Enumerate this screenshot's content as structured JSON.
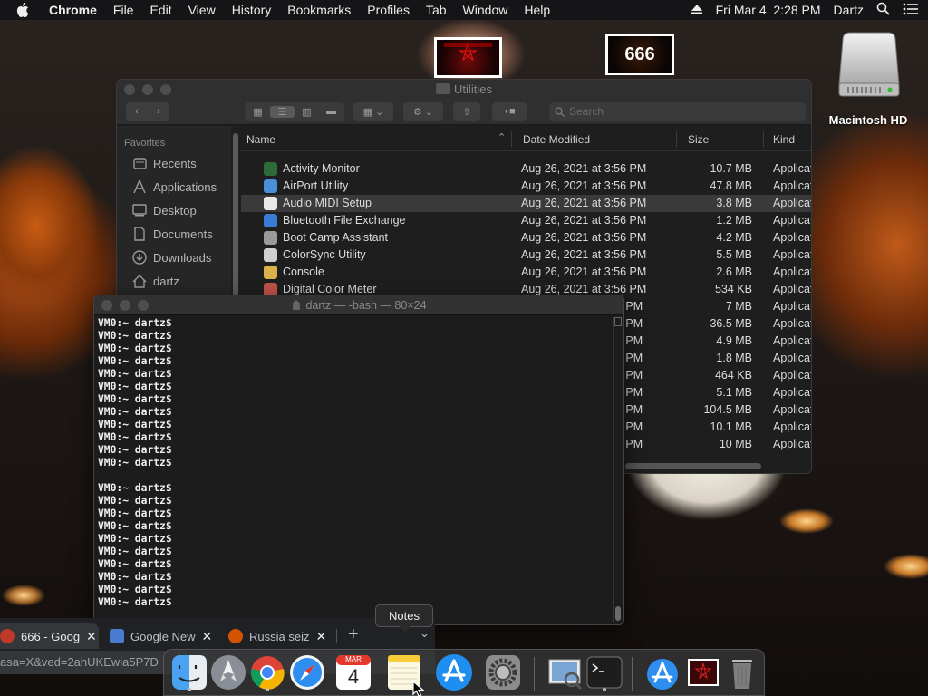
{
  "menubar": {
    "app": "Chrome",
    "items": [
      "File",
      "Edit",
      "View",
      "History",
      "Bookmarks",
      "Profiles",
      "Tab",
      "Window",
      "Help"
    ],
    "datetime": "Fri Mar 4  2:28 PM",
    "user": "Dartz"
  },
  "desktop": {
    "thumb2_text": "666",
    "hd_label": "Macintosh HD"
  },
  "finder": {
    "title": "Utilities",
    "search_placeholder": "Search",
    "sidebar_header": "Favorites",
    "sidebar_items": [
      {
        "label": "Recents",
        "icon": "clock-icon"
      },
      {
        "label": "Applications",
        "icon": "applications-icon"
      },
      {
        "label": "Desktop",
        "icon": "desktop-icon"
      },
      {
        "label": "Documents",
        "icon": "document-icon"
      },
      {
        "label": "Downloads",
        "icon": "download-icon"
      },
      {
        "label": "dartz",
        "icon": "home-icon"
      }
    ],
    "columns": {
      "name": "Name",
      "date": "Date Modified",
      "size": "Size",
      "kind": "Kind"
    },
    "files": [
      {
        "name": "Activity Monitor",
        "date": "Aug 26, 2021 at 3:56 PM",
        "size": "10.7 MB",
        "kind": "Applicat",
        "color": "#2e6b3a"
      },
      {
        "name": "AirPort Utility",
        "date": "Aug 26, 2021 at 3:56 PM",
        "size": "47.8 MB",
        "kind": "Applicat",
        "color": "#4a8fd8"
      },
      {
        "name": "Audio MIDI Setup",
        "date": "Aug 26, 2021 at 3:56 PM",
        "size": "3.8 MB",
        "kind": "Applicat",
        "color": "#e8e8e8"
      },
      {
        "name": "Bluetooth File Exchange",
        "date": "Aug 26, 2021 at 3:56 PM",
        "size": "1.2 MB",
        "kind": "Applicat",
        "color": "#3a7bd5"
      },
      {
        "name": "Boot Camp Assistant",
        "date": "Aug 26, 2021 at 3:56 PM",
        "size": "4.2 MB",
        "kind": "Applicat",
        "color": "#9a9a9a"
      },
      {
        "name": "ColorSync Utility",
        "date": "Aug 26, 2021 at 3:56 PM",
        "size": "5.5 MB",
        "kind": "Applicat",
        "color": "#cfcfcf"
      },
      {
        "name": "Console",
        "date": "Aug 26, 2021 at 3:56 PM",
        "size": "2.6 MB",
        "kind": "Applicat",
        "color": "#d9b24a"
      },
      {
        "name": "Digital Color Meter",
        "date": "Aug 26, 2021 at 3:56 PM",
        "size": "534 KB",
        "kind": "Applicat",
        "color": "#c0534a"
      },
      {
        "name": "",
        "date": "6 PM",
        "size": "7 MB",
        "kind": "Applicat",
        "color": ""
      },
      {
        "name": "",
        "date": "6 PM",
        "size": "36.5 MB",
        "kind": "Applicat",
        "color": ""
      },
      {
        "name": "",
        "date": "6 PM",
        "size": "4.9 MB",
        "kind": "Applicat",
        "color": ""
      },
      {
        "name": "",
        "date": "6 PM",
        "size": "1.8 MB",
        "kind": "Applicat",
        "color": ""
      },
      {
        "name": "",
        "date": "6 PM",
        "size": "464 KB",
        "kind": "Applicat",
        "color": ""
      },
      {
        "name": "",
        "date": "6 PM",
        "size": "5.1 MB",
        "kind": "Applicat",
        "color": ""
      },
      {
        "name": "",
        "date": "6 PM",
        "size": "104.5 MB",
        "kind": "Applicat",
        "color": ""
      },
      {
        "name": "",
        "date": "6 PM",
        "size": "10.1 MB",
        "kind": "Applicat",
        "color": ""
      },
      {
        "name": "",
        "date": "6 PM",
        "size": "10 MB",
        "kind": "Applicat",
        "color": ""
      }
    ]
  },
  "terminal": {
    "title": "dartz — -bash — 80×24",
    "lines": [
      "VM0:~ dartz$",
      "VM0:~ dartz$",
      "VM0:~ dartz$",
      "VM0:~ dartz$",
      "VM0:~ dartz$",
      "VM0:~ dartz$",
      "VM0:~ dartz$",
      "VM0:~ dartz$",
      "VM0:~ dartz$",
      "VM0:~ dartz$",
      "VM0:~ dartz$",
      "VM0:~ dartz$",
      "",
      "VM0:~ dartz$",
      "VM0:~ dartz$",
      "VM0:~ dartz$",
      "VM0:~ dartz$",
      "VM0:~ dartz$",
      "VM0:~ dartz$",
      "VM0:~ dartz$",
      "VM0:~ dartz$",
      "VM0:~ dartz$",
      "VM0:~ dartz$"
    ]
  },
  "chrome": {
    "tabs": [
      {
        "label": "666 - Goog",
        "favicon_color": "#c0392b"
      },
      {
        "label": "Google New",
        "favicon_color": "#4a7bd0"
      },
      {
        "label": "Russia seiz",
        "favicon_color": "#d35400"
      }
    ],
    "new_tab": "+",
    "url": "asa=X&ved=2ahUKEwia5P7D"
  },
  "tooltip": "Notes",
  "dock": {
    "items": [
      {
        "name": "finder",
        "running": true
      },
      {
        "name": "launchpad",
        "running": false
      },
      {
        "name": "chrome",
        "running": true
      },
      {
        "name": "safari",
        "running": false
      },
      {
        "name": "calendar",
        "running": false,
        "month": "MAR",
        "day": "4"
      },
      {
        "name": "notes",
        "running": false
      },
      {
        "name": "app-store",
        "running": false
      },
      {
        "name": "system-preferences",
        "running": false
      },
      {
        "name": "preview",
        "running": false
      },
      {
        "name": "terminal",
        "running": true
      },
      {
        "name": "app-store-2",
        "running": false
      },
      {
        "name": "image-file",
        "running": false
      },
      {
        "name": "trash",
        "running": false
      }
    ]
  }
}
